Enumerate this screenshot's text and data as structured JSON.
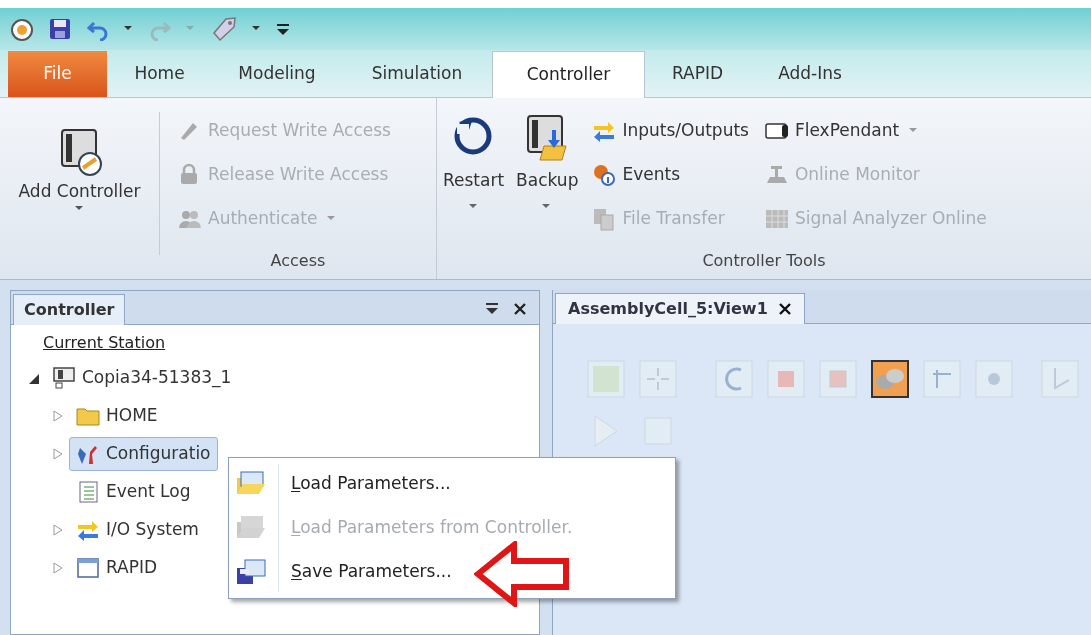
{
  "ribbon_tabs": [
    {
      "label": "File",
      "kind": "file",
      "selected": false
    },
    {
      "label": "Home",
      "kind": "tab",
      "selected": false
    },
    {
      "label": "Modeling",
      "kind": "tab",
      "selected": false
    },
    {
      "label": "Simulation",
      "kind": "tab",
      "selected": false
    },
    {
      "label": "Controller",
      "kind": "tab",
      "selected": true
    },
    {
      "label": "RAPID",
      "kind": "tab",
      "selected": false
    },
    {
      "label": "Add-Ins",
      "kind": "tab",
      "selected": false
    }
  ],
  "ribbon": {
    "add_controller": {
      "label": "Add Controller",
      "dropdown": true
    },
    "access": {
      "label": "Access",
      "items": [
        {
          "label": "Request Write Access",
          "disabled": true,
          "dropdown": false
        },
        {
          "label": "Release Write Access",
          "disabled": true,
          "dropdown": false
        },
        {
          "label": "Authenticate",
          "disabled": true,
          "dropdown": true
        }
      ]
    },
    "controller_tools": {
      "label": "Controller Tools",
      "large_buttons": [
        {
          "label": "Restart",
          "dropdown": true
        },
        {
          "label": "Backup",
          "dropdown": true
        }
      ],
      "column_1": [
        {
          "label": "Inputs/Outputs",
          "disabled": false,
          "dropdown": false
        },
        {
          "label": "Events",
          "disabled": false,
          "dropdown": false
        },
        {
          "label": "File Transfer",
          "disabled": true,
          "dropdown": false
        }
      ],
      "column_2": [
        {
          "label": "FlexPendant",
          "disabled": false,
          "dropdown": true
        },
        {
          "label": "Online Monitor",
          "disabled": true,
          "dropdown": false
        },
        {
          "label": "Signal Analyzer Online",
          "disabled": true,
          "dropdown": false
        }
      ]
    }
  },
  "controller_panel": {
    "title": "Controller",
    "header": "Current Station",
    "tree": [
      {
        "label": "Copia34-51383_1",
        "expandable": true,
        "expanded": true,
        "selected": false,
        "children": [
          {
            "label": "HOME",
            "expandable": true,
            "expanded": false,
            "selected": false
          },
          {
            "label": "Configuratio",
            "expandable": true,
            "expanded": false,
            "selected": true
          },
          {
            "label": "Event Log",
            "expandable": false,
            "expanded": false,
            "selected": false
          },
          {
            "label": "I/O System",
            "expandable": true,
            "expanded": false,
            "selected": false
          },
          {
            "label": "RAPID",
            "expandable": true,
            "expanded": false,
            "selected": false
          }
        ]
      }
    ]
  },
  "context_menu": [
    {
      "label": "Load Parameters...",
      "disabled": false
    },
    {
      "label": "Load Parameters from Controller.",
      "disabled": true
    },
    {
      "label": "Save Parameters...",
      "disabled": false
    }
  ],
  "document_tab": {
    "title": "AssemblyCell_5:View1",
    "selected": true
  }
}
